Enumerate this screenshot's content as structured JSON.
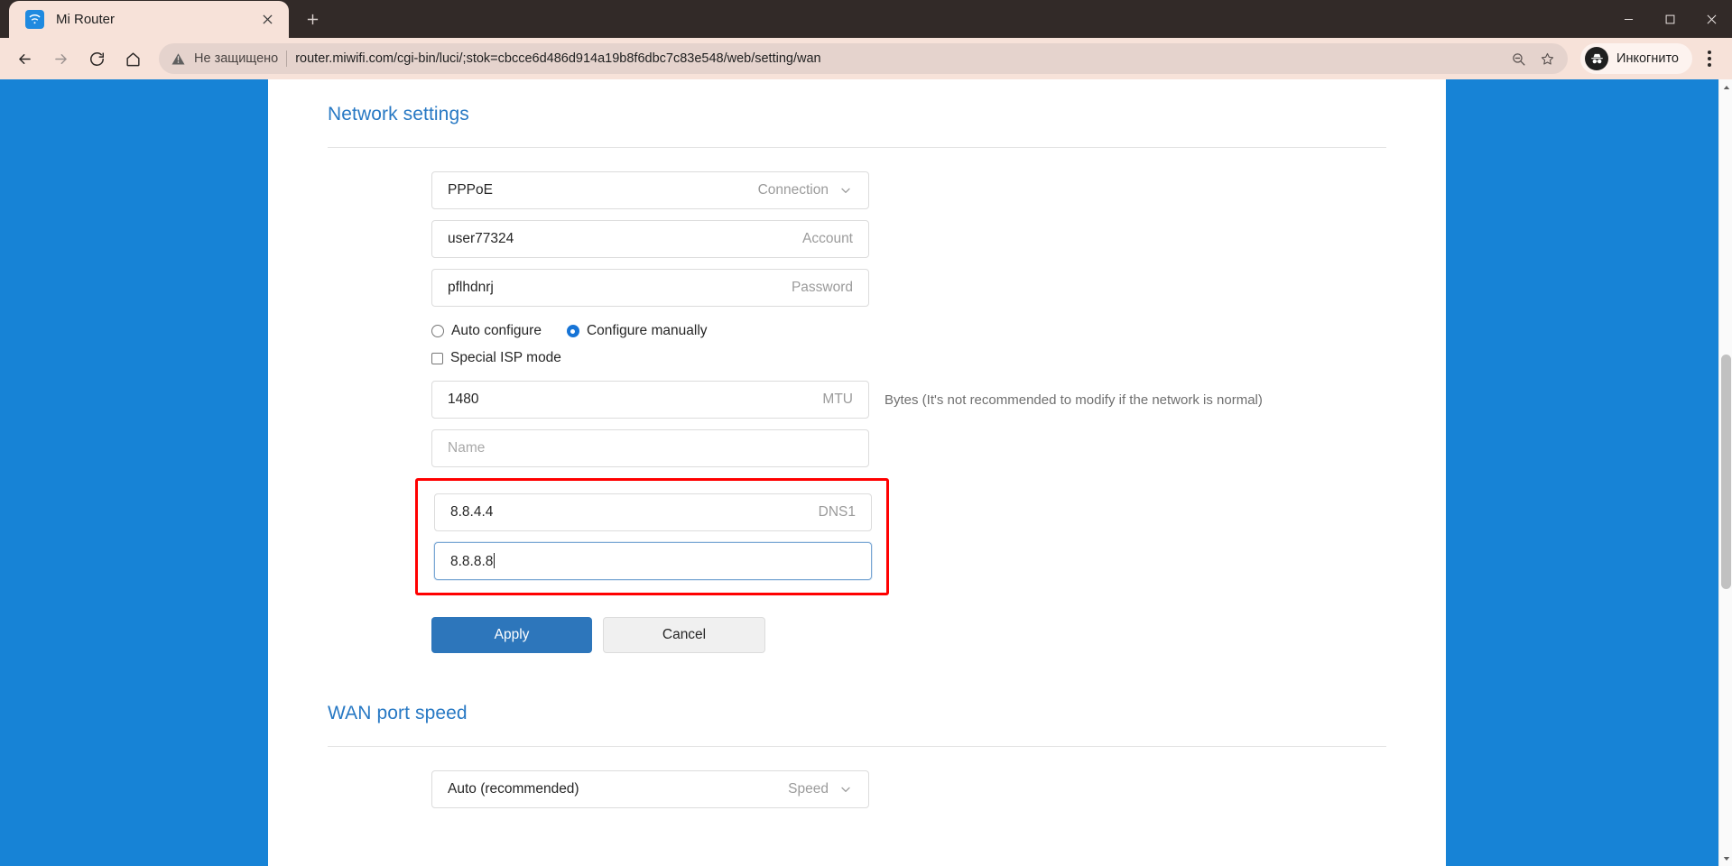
{
  "browser": {
    "tab": {
      "title": "Mi Router",
      "favicon_icon": "wifi-icon",
      "close_icon": "close-icon"
    },
    "new_tab_icon": "plus-icon",
    "window_controls": {
      "minimize_icon": "minimize-icon",
      "maximize_icon": "maximize-icon",
      "close_icon": "close-icon"
    },
    "nav": {
      "back_icon": "arrow-left-icon",
      "forward_icon": "arrow-right-icon",
      "reload_icon": "reload-icon",
      "home_icon": "home-icon"
    },
    "omnibox": {
      "security_icon": "warning-triangle-icon",
      "security_label": "Не защищено",
      "url": "router.miwifi.com/cgi-bin/luci/;stok=cbcce6d486d914a19b8f6dbc7c83e548/web/setting/wan",
      "zoom_icon": "zoom-out-icon",
      "bookmark_icon": "star-icon"
    },
    "profile": {
      "avatar_icon": "incognito-icon",
      "label": "Инкогнито"
    },
    "menu_icon": "three-dots-vertical-icon"
  },
  "page": {
    "network_settings": {
      "title": "Network settings",
      "connection": {
        "value": "PPPoE",
        "label": "Connection",
        "chevron_icon": "chevron-down-icon"
      },
      "account": {
        "value": "user77324",
        "label": "Account"
      },
      "password": {
        "value": "pflhdnrj",
        "label": "Password"
      },
      "config_mode": {
        "auto": {
          "label": "Auto configure",
          "checked": false
        },
        "manual": {
          "label": "Configure manually",
          "checked": true
        }
      },
      "special_isp": {
        "label": "Special ISP mode",
        "checked": false
      },
      "mtu": {
        "value": "1480",
        "label": "MTU",
        "hint": "Bytes (It's not recommended to modify if the network is normal)"
      },
      "name": {
        "value": "",
        "placeholder": "Name"
      },
      "dns1": {
        "value": "8.8.4.4",
        "label": "DNS1"
      },
      "dns2": {
        "value": "8.8.8.8",
        "label": "",
        "focused": true
      },
      "apply_label": "Apply",
      "cancel_label": "Cancel"
    },
    "wan_port_speed": {
      "title": "WAN port speed",
      "speed": {
        "value": "Auto (recommended)",
        "label": "Speed",
        "chevron_icon": "chevron-down-icon"
      }
    }
  },
  "scrollbar": {
    "up_icon": "caret-up-icon",
    "down_icon": "caret-down-icon"
  },
  "colors": {
    "accent": "#2879c4",
    "primary_button": "#2d76bb",
    "highlight": "#ff0000",
    "page_bg": "#1783d6"
  }
}
